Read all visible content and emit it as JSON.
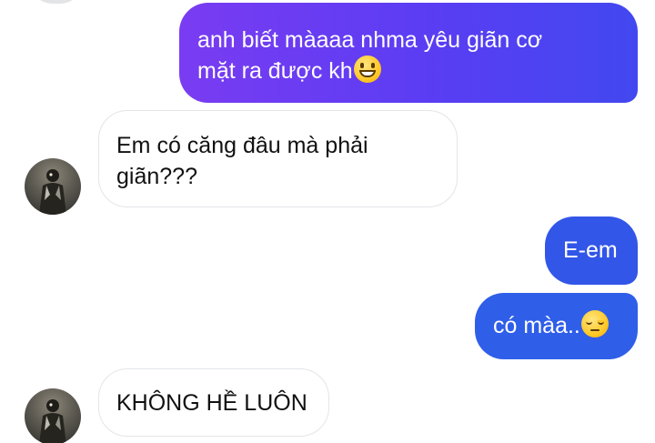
{
  "conversation": {
    "messages": [
      {
        "sender": "outgoing",
        "text": "anh biết màaaa nhma yêu giãn cơ\nmặt ra được kh",
        "emoji": "grinning-face"
      },
      {
        "sender": "incoming",
        "text": "Em có căng đâu mà phải\ngiãn???"
      },
      {
        "sender": "outgoing",
        "text": "E-em"
      },
      {
        "sender": "outgoing",
        "text": "có màa..",
        "emoji": "pensive-face"
      },
      {
        "sender": "incoming",
        "text": "KHÔNG HỀ LUÔN"
      }
    ]
  },
  "colors": {
    "outgoing_gradient_start": "#7a3cf2",
    "outgoing_gradient_end": "#4248f0",
    "outgoing_blue": "#2f5ee9",
    "incoming_border": "#e3e5e8",
    "incoming_text": "#111111"
  },
  "icons": {
    "contact_avatar": "contact-avatar-photo"
  }
}
